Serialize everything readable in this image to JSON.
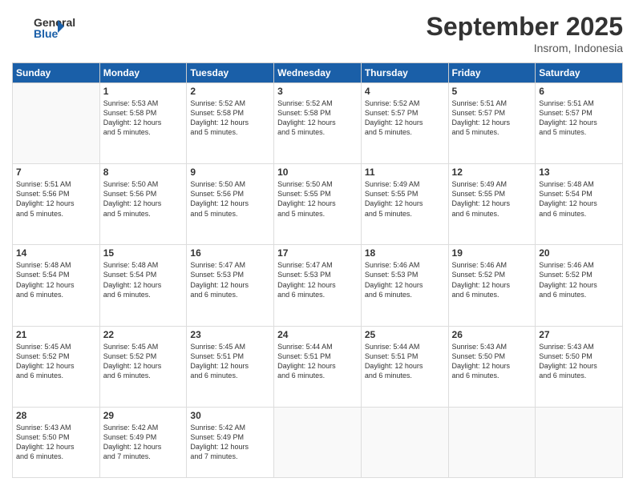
{
  "logo": {
    "line1": "General",
    "line2": "Blue"
  },
  "title": "September 2025",
  "location": "Insrom, Indonesia",
  "weekdays": [
    "Sunday",
    "Monday",
    "Tuesday",
    "Wednesday",
    "Thursday",
    "Friday",
    "Saturday"
  ],
  "weeks": [
    [
      {
        "day": "",
        "info": ""
      },
      {
        "day": "1",
        "info": "Sunrise: 5:53 AM\nSunset: 5:58 PM\nDaylight: 12 hours\nand 5 minutes."
      },
      {
        "day": "2",
        "info": "Sunrise: 5:52 AM\nSunset: 5:58 PM\nDaylight: 12 hours\nand 5 minutes."
      },
      {
        "day": "3",
        "info": "Sunrise: 5:52 AM\nSunset: 5:58 PM\nDaylight: 12 hours\nand 5 minutes."
      },
      {
        "day": "4",
        "info": "Sunrise: 5:52 AM\nSunset: 5:57 PM\nDaylight: 12 hours\nand 5 minutes."
      },
      {
        "day": "5",
        "info": "Sunrise: 5:51 AM\nSunset: 5:57 PM\nDaylight: 12 hours\nand 5 minutes."
      },
      {
        "day": "6",
        "info": "Sunrise: 5:51 AM\nSunset: 5:57 PM\nDaylight: 12 hours\nand 5 minutes."
      }
    ],
    [
      {
        "day": "7",
        "info": "Sunrise: 5:51 AM\nSunset: 5:56 PM\nDaylight: 12 hours\nand 5 minutes."
      },
      {
        "day": "8",
        "info": "Sunrise: 5:50 AM\nSunset: 5:56 PM\nDaylight: 12 hours\nand 5 minutes."
      },
      {
        "day": "9",
        "info": "Sunrise: 5:50 AM\nSunset: 5:56 PM\nDaylight: 12 hours\nand 5 minutes."
      },
      {
        "day": "10",
        "info": "Sunrise: 5:50 AM\nSunset: 5:55 PM\nDaylight: 12 hours\nand 5 minutes."
      },
      {
        "day": "11",
        "info": "Sunrise: 5:49 AM\nSunset: 5:55 PM\nDaylight: 12 hours\nand 5 minutes."
      },
      {
        "day": "12",
        "info": "Sunrise: 5:49 AM\nSunset: 5:55 PM\nDaylight: 12 hours\nand 6 minutes."
      },
      {
        "day": "13",
        "info": "Sunrise: 5:48 AM\nSunset: 5:54 PM\nDaylight: 12 hours\nand 6 minutes."
      }
    ],
    [
      {
        "day": "14",
        "info": "Sunrise: 5:48 AM\nSunset: 5:54 PM\nDaylight: 12 hours\nand 6 minutes."
      },
      {
        "day": "15",
        "info": "Sunrise: 5:48 AM\nSunset: 5:54 PM\nDaylight: 12 hours\nand 6 minutes."
      },
      {
        "day": "16",
        "info": "Sunrise: 5:47 AM\nSunset: 5:53 PM\nDaylight: 12 hours\nand 6 minutes."
      },
      {
        "day": "17",
        "info": "Sunrise: 5:47 AM\nSunset: 5:53 PM\nDaylight: 12 hours\nand 6 minutes."
      },
      {
        "day": "18",
        "info": "Sunrise: 5:46 AM\nSunset: 5:53 PM\nDaylight: 12 hours\nand 6 minutes."
      },
      {
        "day": "19",
        "info": "Sunrise: 5:46 AM\nSunset: 5:52 PM\nDaylight: 12 hours\nand 6 minutes."
      },
      {
        "day": "20",
        "info": "Sunrise: 5:46 AM\nSunset: 5:52 PM\nDaylight: 12 hours\nand 6 minutes."
      }
    ],
    [
      {
        "day": "21",
        "info": "Sunrise: 5:45 AM\nSunset: 5:52 PM\nDaylight: 12 hours\nand 6 minutes."
      },
      {
        "day": "22",
        "info": "Sunrise: 5:45 AM\nSunset: 5:52 PM\nDaylight: 12 hours\nand 6 minutes."
      },
      {
        "day": "23",
        "info": "Sunrise: 5:45 AM\nSunset: 5:51 PM\nDaylight: 12 hours\nand 6 minutes."
      },
      {
        "day": "24",
        "info": "Sunrise: 5:44 AM\nSunset: 5:51 PM\nDaylight: 12 hours\nand 6 minutes."
      },
      {
        "day": "25",
        "info": "Sunrise: 5:44 AM\nSunset: 5:51 PM\nDaylight: 12 hours\nand 6 minutes."
      },
      {
        "day": "26",
        "info": "Sunrise: 5:43 AM\nSunset: 5:50 PM\nDaylight: 12 hours\nand 6 minutes."
      },
      {
        "day": "27",
        "info": "Sunrise: 5:43 AM\nSunset: 5:50 PM\nDaylight: 12 hours\nand 6 minutes."
      }
    ],
    [
      {
        "day": "28",
        "info": "Sunrise: 5:43 AM\nSunset: 5:50 PM\nDaylight: 12 hours\nand 6 minutes."
      },
      {
        "day": "29",
        "info": "Sunrise: 5:42 AM\nSunset: 5:49 PM\nDaylight: 12 hours\nand 7 minutes."
      },
      {
        "day": "30",
        "info": "Sunrise: 5:42 AM\nSunset: 5:49 PM\nDaylight: 12 hours\nand 7 minutes."
      },
      {
        "day": "",
        "info": ""
      },
      {
        "day": "",
        "info": ""
      },
      {
        "day": "",
        "info": ""
      },
      {
        "day": "",
        "info": ""
      }
    ]
  ]
}
